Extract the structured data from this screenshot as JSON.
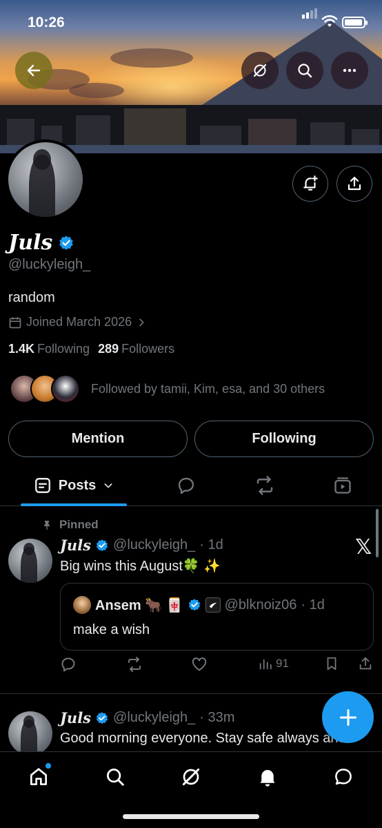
{
  "status_bar": {
    "time": "10:26"
  },
  "profile": {
    "display_name": "Juls",
    "handle": "@luckyleigh_",
    "bio": "random",
    "joined": "Joined March 2026",
    "following_count": "1.4K",
    "following_label": "Following",
    "followers_count": "289",
    "followers_label": "Followers",
    "followed_by": "Followed by tamii, Kim, esa, and 30 others",
    "mention_label": "Mention",
    "following_button_label": "Following"
  },
  "tabs": {
    "posts_label": "Posts"
  },
  "posts": [
    {
      "pinned_label": "Pinned",
      "author": "Juls",
      "handle": "@luckyleigh_",
      "time": "· 1d",
      "text": "Big wins this August🍀 ✨",
      "quote": {
        "author": "Ansem 🐂 🀄",
        "handle": "@blknoiz06",
        "time": "· 1d",
        "text": "make a wish"
      },
      "views": "91"
    },
    {
      "author": "Juls",
      "handle": "@luckyleigh_",
      "time": "· 33m",
      "text": "Good morning everyone. Stay safe always and"
    }
  ],
  "colors": {
    "accent": "#1d9bf0",
    "background": "#000000",
    "secondary_text": "#71767b",
    "border": "#2f3336"
  },
  "icons": [
    "back-arrow-icon",
    "grok-icon",
    "search-icon",
    "more-icon",
    "notification-add-icon",
    "share-icon",
    "calendar-icon",
    "chevron-right-icon",
    "posts-icon",
    "chevron-down-icon",
    "reply-icon",
    "repost-icon",
    "media-icon",
    "pin-icon",
    "x-logo-icon",
    "like-icon",
    "views-icon",
    "bookmark-icon",
    "compose-plus-icon",
    "home-icon",
    "messages-icon"
  ]
}
